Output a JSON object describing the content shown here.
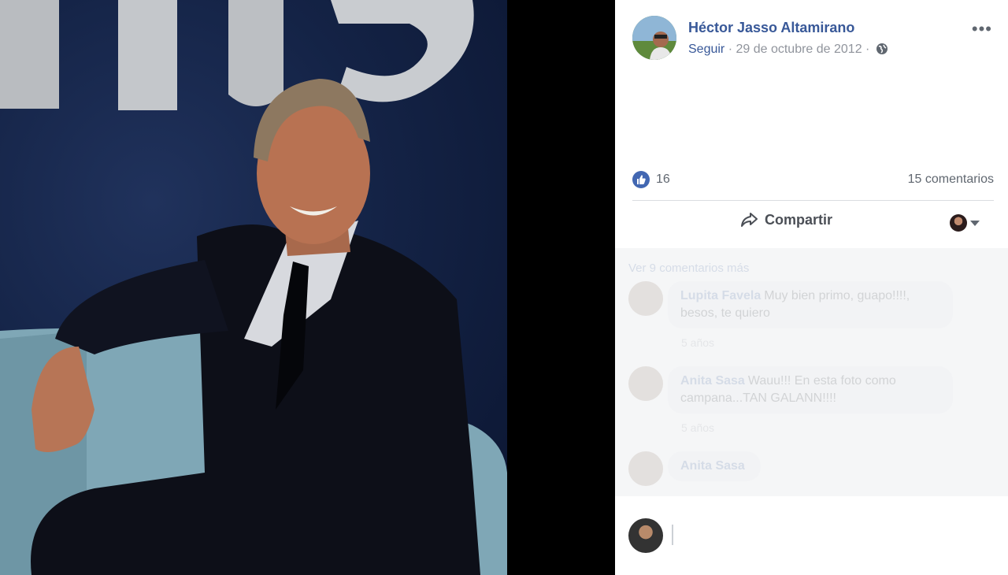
{
  "post": {
    "author": "Héctor Jasso Altamirano",
    "follow_label": "Seguir",
    "separator": " · ",
    "date": "29 de octubre de 2012",
    "separator2": " · ",
    "privacy_icon": "globe-icon",
    "more_icon": "more-options-icon"
  },
  "reactions": {
    "like_icon": "like-icon",
    "like_count": "16",
    "comments_count": "15 comentarios"
  },
  "actions": {
    "share_label": "Compartir",
    "share_icon": "share-arrow-icon"
  },
  "comments": {
    "view_more": "Ver 9 comentarios más",
    "items": [
      {
        "author": "Lupita Favela",
        "text": "Muy bien primo, guapo!!!!, besos, te quiero",
        "time": "5 años"
      },
      {
        "author": "Anita Sasa",
        "text": "Wauu!!! En esta foto como campana...TAN GALANN!!!!",
        "time": "5 años"
      },
      {
        "author": "Anita Sasa",
        "text": ""
      }
    ]
  },
  "colors": {
    "link": "#385898",
    "like": "#4267b2",
    "meta": "#90949c"
  }
}
